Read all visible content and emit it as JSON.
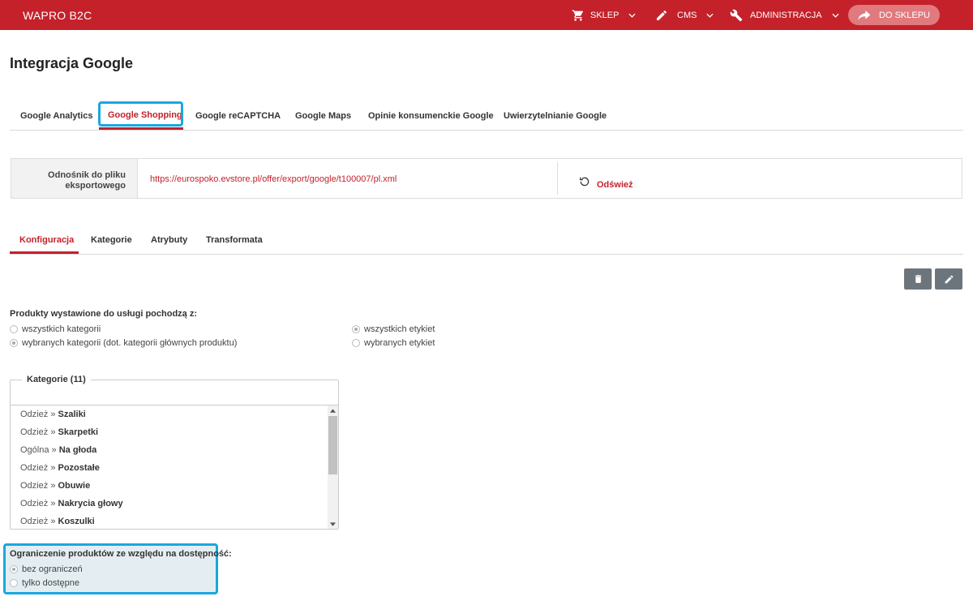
{
  "header": {
    "brand": "WAPRO B2C",
    "nav": [
      {
        "label": "SKLEP",
        "icon": "cart-icon"
      },
      {
        "label": "CMS",
        "icon": "pencil-icon"
      },
      {
        "label": "ADMINISTRACJA",
        "icon": "wrench-icon"
      }
    ],
    "shop_button": "DO SKLEPU"
  },
  "page_title": "Integracja Google",
  "google_tabs": [
    {
      "label": "Google Analytics",
      "active": false
    },
    {
      "label": "Google Shopping",
      "active": true
    },
    {
      "label": "Google reCAPTCHA",
      "active": false
    },
    {
      "label": "Google Maps",
      "active": false
    },
    {
      "label": "Opinie konsumenckie Google",
      "active": false
    },
    {
      "label": "Uwierzytelnianie Google",
      "active": false
    }
  ],
  "export": {
    "label_line1": "Odnośnik do pliku",
    "label_line2": "eksportowego",
    "url": "https://eurospoko.evstore.pl/offer/export/google/t100007/pl.xml",
    "refresh_label": "Odśwież"
  },
  "sub_tabs": [
    {
      "label": "Konfiguracja",
      "active": true
    },
    {
      "label": "Kategorie",
      "active": false
    },
    {
      "label": "Atrybuty",
      "active": false
    },
    {
      "label": "Transformata",
      "active": false
    }
  ],
  "actions": {
    "delete_icon": "trash-icon",
    "edit_icon": "pencil-icon"
  },
  "source": {
    "title": "Produkty wystawione do usługi pochodzą z:",
    "categories": [
      {
        "label": "wszystkich kategorii",
        "checked": false
      },
      {
        "label": "wybranych kategorii (dot. kategorii głównych produktu)",
        "checked": true
      }
    ],
    "labels": [
      {
        "label": "wszystkich etykiet",
        "checked": true
      },
      {
        "label": "wybranych etykiet",
        "checked": false
      }
    ]
  },
  "categories_box": {
    "legend": "Kategorie (11)",
    "items": [
      {
        "parent": "Odzież",
        "name": "Szaliki"
      },
      {
        "parent": "Odzież",
        "name": "Skarpetki"
      },
      {
        "parent": "Ogólna",
        "name": "Na głoda"
      },
      {
        "parent": "Odzież",
        "name": "Pozostałe"
      },
      {
        "parent": "Odzież",
        "name": "Obuwie"
      },
      {
        "parent": "Odzież",
        "name": "Nakrycia głowy"
      },
      {
        "parent": "Odzież",
        "name": "Koszulki"
      }
    ],
    "separator": "»"
  },
  "availability": {
    "title": "Ograniczenie produktów ze względu na dostępność:",
    "options": [
      {
        "label": "bez ograniczeń",
        "checked": true
      },
      {
        "label": "tylko dostępne",
        "checked": false
      }
    ]
  },
  "colors": {
    "accent": "#c4212b",
    "highlight": "#1aa7df",
    "button_gray": "#6d757c"
  }
}
